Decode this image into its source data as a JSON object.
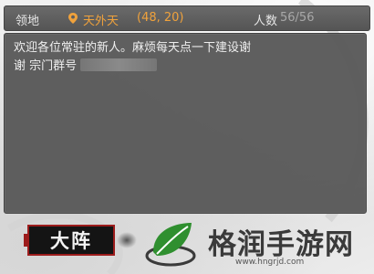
{
  "header": {
    "territory_label": "领地",
    "territory_name": "天外天",
    "coords": "(48, 20)",
    "count_label": "人数",
    "count": "56/56"
  },
  "notice": {
    "text_line1": "欢迎各位常驻的新人。麻烦每天点一下建设谢",
    "text_line2": "谢 宗门群号"
  },
  "formation_button": {
    "label": "大阵"
  },
  "watermark": {
    "title": "格润手游网",
    "url": "www.hngrjd.com"
  },
  "colors": {
    "accent": "#f0a23c",
    "panel": "#585858",
    "button_border": "#9c1c1c"
  },
  "icons": {
    "location": "map-pin-icon",
    "logo": "leaf-logo-icon"
  }
}
